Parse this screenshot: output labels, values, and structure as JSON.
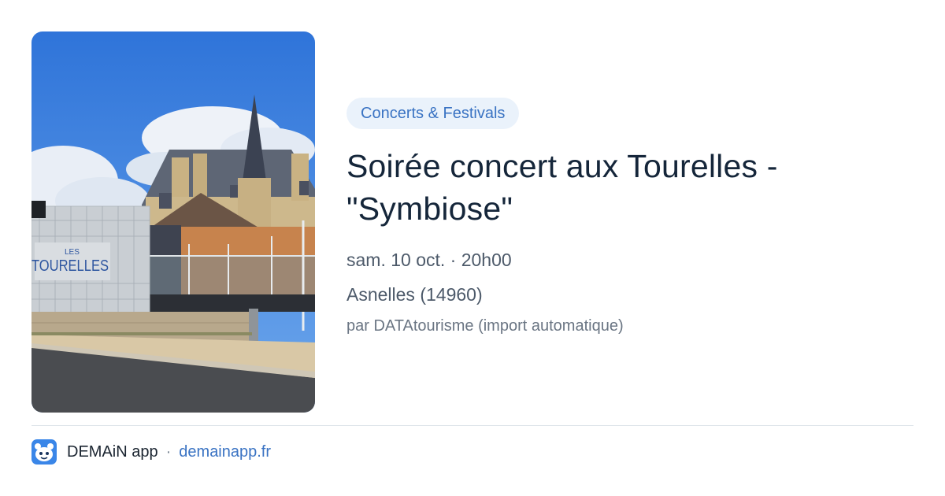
{
  "event": {
    "category": "Concerts & Festivals",
    "title": "Soirée concert aux Tourelles - \"Symbiose\"",
    "date": "sam. 10 oct. · 20h00",
    "location": "Asnelles (14960)",
    "source": "par DATAtourisme (import automatique)"
  },
  "image": {
    "sign_top": "LES",
    "sign_main": "TOURELLES"
  },
  "footer": {
    "app_name": "DEMAiN app",
    "separator": "·",
    "url": "demainapp.fr",
    "icon": "demain-app-icon"
  },
  "colors": {
    "accent": "#3a73c3",
    "tag_background": "#eaf2fb",
    "title": "#15263a"
  }
}
